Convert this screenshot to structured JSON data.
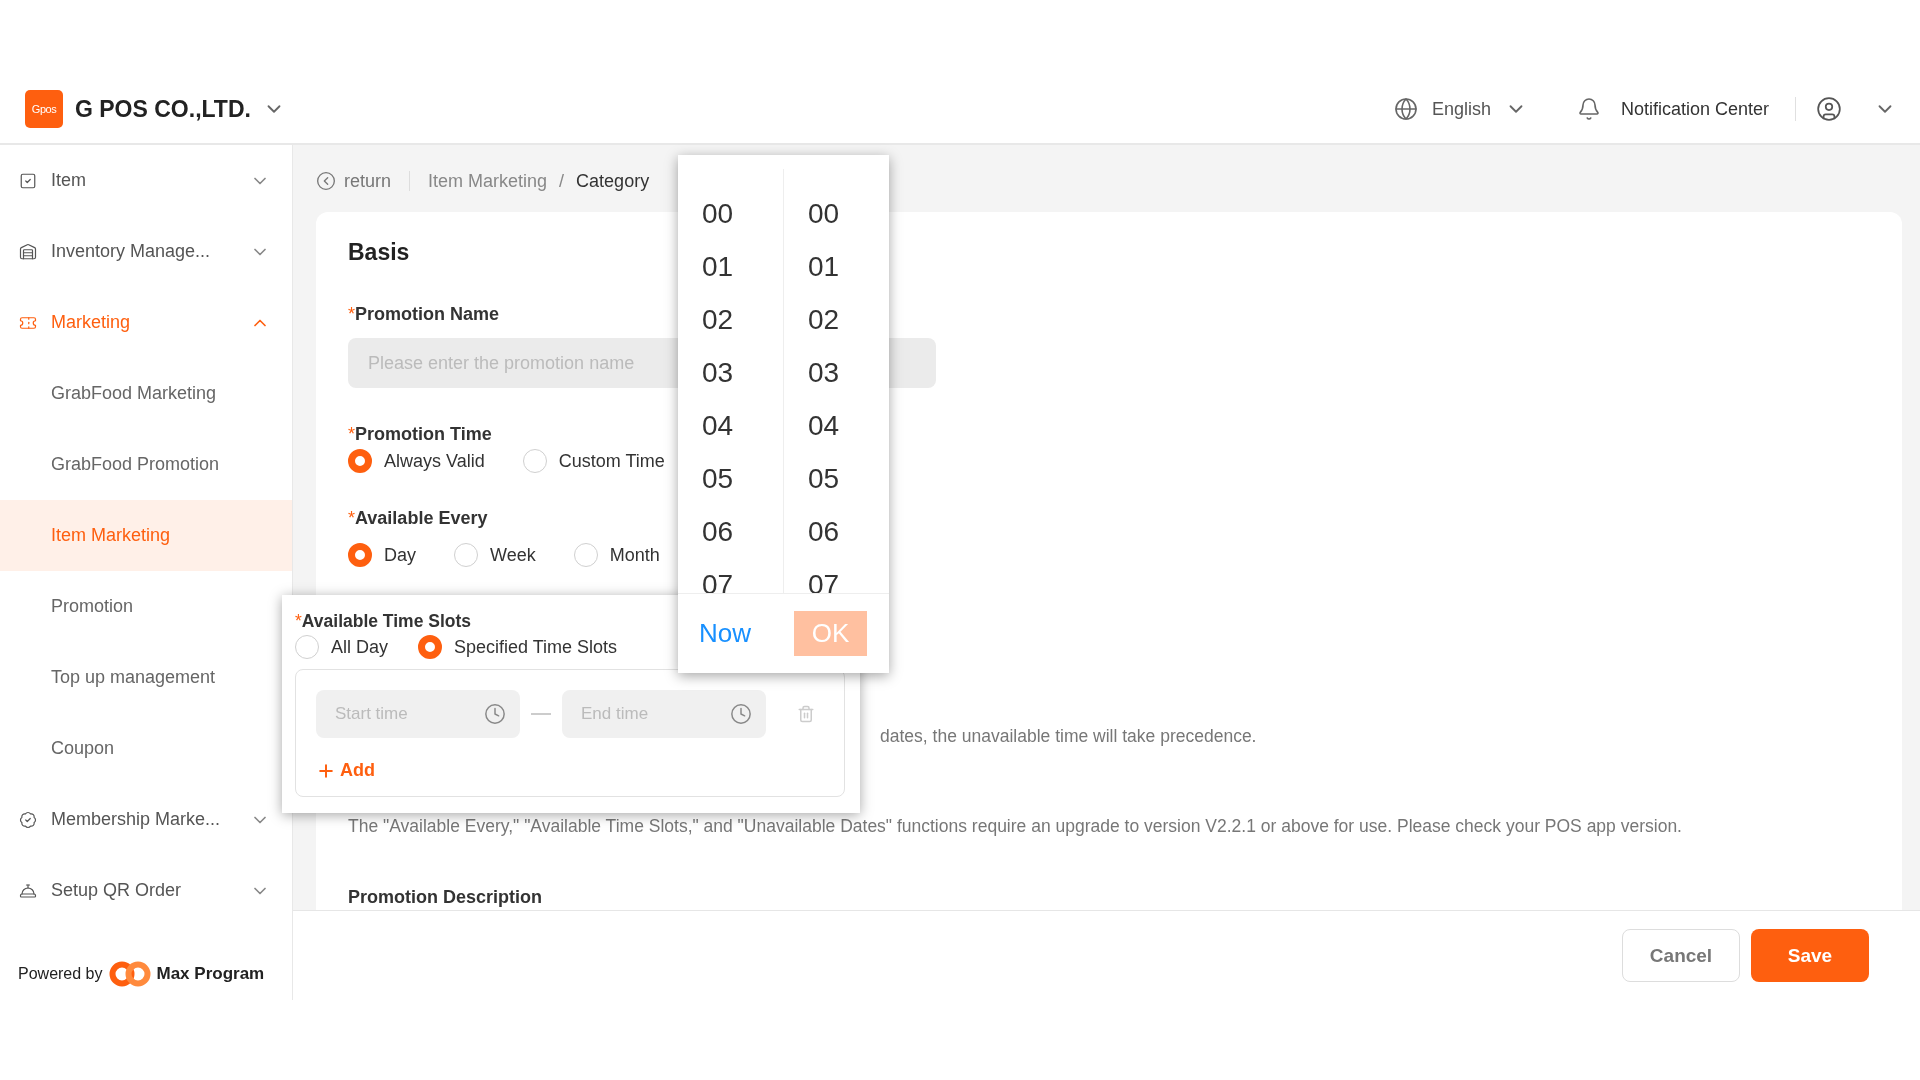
{
  "header": {
    "logo_text": "Gpos",
    "company": "G POS CO.,LTD.",
    "language": "English",
    "notifications": "Notification Center"
  },
  "sidebar": {
    "items": [
      {
        "label": "Item",
        "kind": "group",
        "active": false,
        "expanded": false
      },
      {
        "label": "Inventory Manage...",
        "kind": "group",
        "active": false,
        "expanded": false
      },
      {
        "label": "Marketing",
        "kind": "group",
        "active": true,
        "expanded": true,
        "children": [
          {
            "label": "GrabFood Marketing",
            "selected": false
          },
          {
            "label": "GrabFood Promotion",
            "selected": false
          },
          {
            "label": "Item Marketing",
            "selected": true
          },
          {
            "label": "Promotion",
            "selected": false
          },
          {
            "label": "Top up management",
            "selected": false
          },
          {
            "label": "Coupon",
            "selected": false
          }
        ]
      },
      {
        "label": "Membership Marke...",
        "kind": "group",
        "active": false,
        "expanded": false
      },
      {
        "label": "Setup QR Order",
        "kind": "group",
        "active": false,
        "expanded": false
      }
    ],
    "powered_by": "Powered by",
    "brand": "Max Program"
  },
  "breadcrumb": {
    "back": "return",
    "items": [
      {
        "label": "Item Marketing",
        "current": false
      },
      {
        "label": "Category",
        "current": true
      }
    ],
    "separator": "/"
  },
  "form": {
    "section": "Basis",
    "promotion_name": {
      "mark": "*",
      "label": "Promotion Name",
      "placeholder": "Please enter the promotion name"
    },
    "promotion_time": {
      "mark": "*",
      "label": "Promotion Time",
      "options": [
        {
          "label": "Always Valid",
          "selected": true
        },
        {
          "label": "Custom Time",
          "selected": false
        }
      ]
    },
    "available_every": {
      "mark": "*",
      "label": "Available Every",
      "options": [
        {
          "label": "Day",
          "selected": true
        },
        {
          "label": "Week",
          "selected": false
        },
        {
          "label": "Month",
          "selected": false
        }
      ]
    },
    "note_fragment": "dates, the unavailable time will take precedence.",
    "version_note": "The \"Available Every,\" \"Available Time Slots,\" and \"Unavailable Dates\" functions require an upgrade to version V2.2.1 or above for use. Please check your POS app version.",
    "description_label": "Promotion Description"
  },
  "time_slots_popover": {
    "mark": "*",
    "label": "Available Time Slots",
    "options": [
      {
        "label": "All Day",
        "selected": false
      },
      {
        "label": "Specified Time Slots",
        "selected": true
      }
    ],
    "start_placeholder": "Start time",
    "end_placeholder": "End time",
    "add": "Add"
  },
  "time_picker": {
    "hours": [
      "00",
      "01",
      "02",
      "03",
      "04",
      "05",
      "06",
      "07"
    ],
    "minutes": [
      "00",
      "01",
      "02",
      "03",
      "04",
      "05",
      "06",
      "07"
    ],
    "now": "Now",
    "ok": "OK",
    "ok_disabled": true
  },
  "footer": {
    "cancel": "Cancel",
    "save": "Save"
  }
}
